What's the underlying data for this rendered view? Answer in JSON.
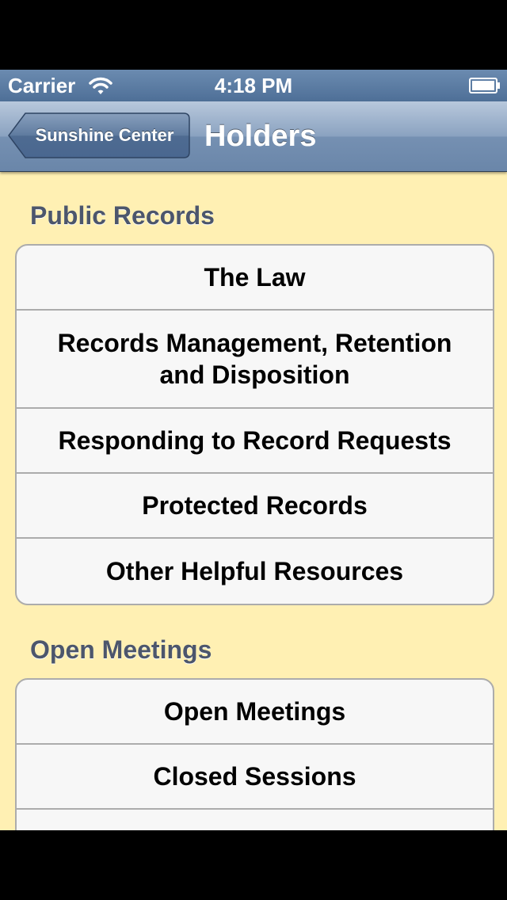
{
  "status_bar": {
    "carrier": "Carrier",
    "time": "4:18 PM"
  },
  "nav_bar": {
    "back_label": "Sunshine Center",
    "title": "Holders"
  },
  "sections": [
    {
      "header": "Public Records",
      "items": [
        "The Law",
        "Records Management, Retention and Disposition",
        "Responding to Record Requests",
        "Protected Records",
        "Other Helpful Resources"
      ]
    },
    {
      "header": "Open Meetings",
      "items": [
        "Open Meetings",
        "Closed Sessions",
        ""
      ]
    }
  ],
  "colors": {
    "background": "#fff0b3",
    "nav_bar": "#7590b2",
    "section_header": "#4c566c",
    "cell_background": "#f7f7f7"
  }
}
